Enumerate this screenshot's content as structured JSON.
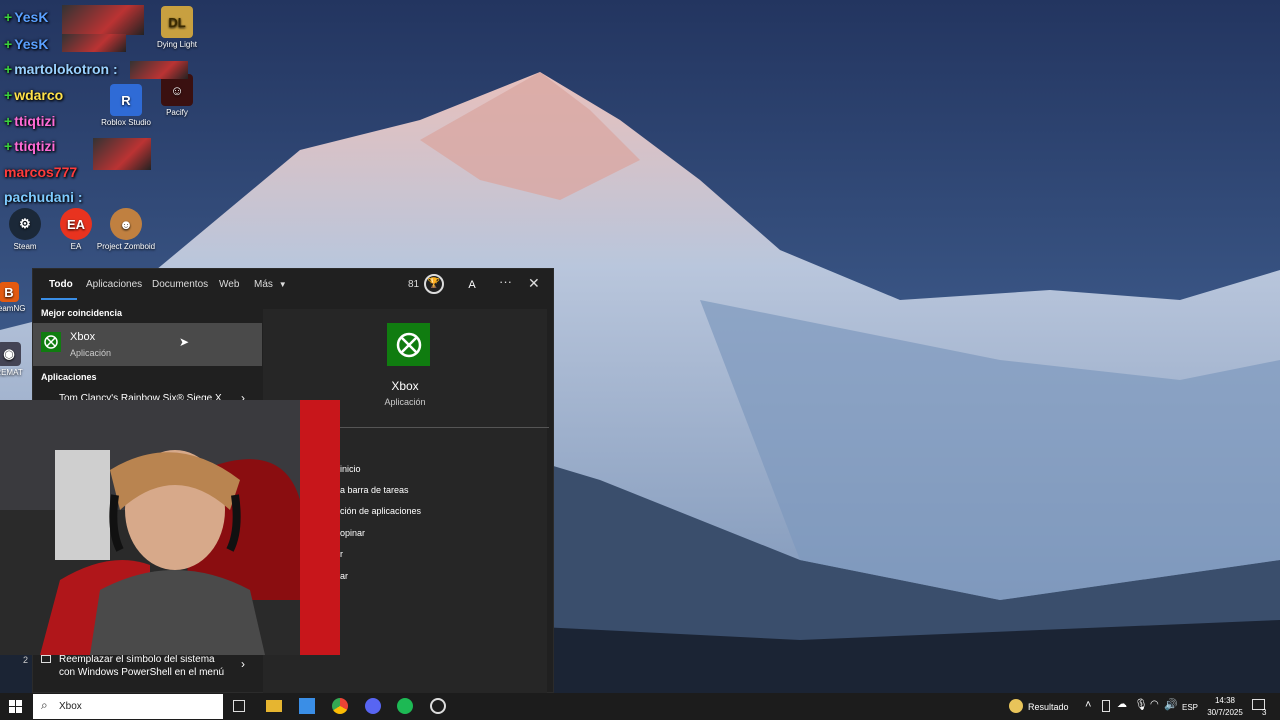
{
  "desktop": {
    "icons": [
      {
        "label": "Dying Light"
      },
      {
        "label": "Pacify"
      },
      {
        "label": "Steam"
      },
      {
        "label": "EA"
      },
      {
        "label": "Project Zomboid"
      },
      {
        "label": "Roblox Studio"
      },
      {
        "label": "BeamNG"
      },
      {
        "label": "REMAT"
      }
    ],
    "chat": [
      {
        "user": "YesK",
        "plus": "+"
      },
      {
        "user": "YesK",
        "plus": "+"
      },
      {
        "user": "martolokotron :",
        "plus": "+"
      },
      {
        "user": "wdarco",
        "plus": "+"
      },
      {
        "user": "ttiqtizi",
        "plus": "+"
      },
      {
        "user": "ttiqtizi",
        "plus": "+"
      },
      {
        "user": "marcos777",
        "plus": ""
      },
      {
        "user": "pachudani :",
        "plus": ""
      }
    ]
  },
  "search_panel": {
    "tabs": [
      "Todo",
      "Aplicaciones",
      "Documentos",
      "Web",
      "Más"
    ],
    "points": "81",
    "avatar_letter": "A",
    "best_match_heading": "Mejor coincidencia",
    "best_match": {
      "title": "Xbox",
      "subtitle": "Aplicación"
    },
    "apps_heading": "Aplicaciones",
    "app_result": "Tom Clancy's Rainbow Six® Siege X",
    "bottom_result": {
      "line1": "Reemplazar el símbolo del sistema",
      "line2": "con Windows PowerShell en el menú",
      "index": "2"
    },
    "detail": {
      "title": "Xbox",
      "subtitle": "Aplicación"
    },
    "actions": [
      "inicio",
      "a barra de tareas",
      "ción de aplicaciones",
      "opinar",
      "r",
      "ar"
    ]
  },
  "taskbar": {
    "search_value": "Xbox",
    "weather_label": "Resultado",
    "language": "ESP",
    "time": "14:38",
    "date": "30/7/2025",
    "notification_count": "3"
  }
}
